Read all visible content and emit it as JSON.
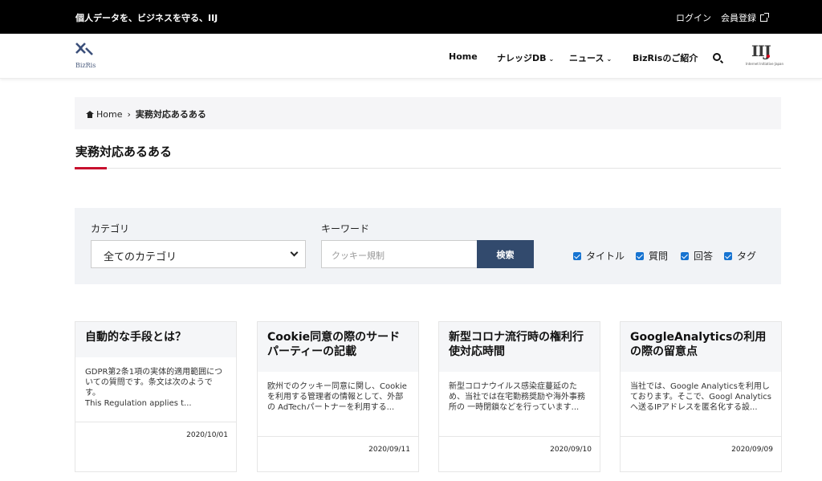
{
  "topbar": {
    "tagline": "個人データを、ビジネスを守る、IIJ",
    "login": "ログイン",
    "register": "会員登録"
  },
  "header": {
    "logo_text": "BizRis",
    "nav": [
      {
        "label": "Home",
        "caret": false
      },
      {
        "label": "ナレッジDB",
        "caret": true
      },
      {
        "label": "ニュース",
        "caret": true
      },
      {
        "label": "BizRisのご紹介",
        "caret": false
      }
    ],
    "partner_logo": "IIJ",
    "partner_sub": "Internet Initiative Japan"
  },
  "breadcrumb": {
    "home": "Home",
    "separator": "›",
    "current": "実務対応あるある"
  },
  "page_title": "実務対応あるある",
  "search": {
    "category_label": "カテゴリ",
    "category_value": "全てのカテゴリ",
    "keyword_label": "キーワード",
    "keyword_placeholder": "クッキー規制",
    "button": "検索",
    "checkboxes": [
      "タイトル",
      "質問",
      "回答",
      "タグ"
    ]
  },
  "cards": [
    {
      "title": "自動的な手段とは？",
      "excerpt": "GDPR第2条1項の実体的適用範囲についての質問です。条文は次のようです。\nThis Regulation applies t...",
      "date": "2020/10/01"
    },
    {
      "title": "Cookie同意の際のサードパーティーの記載",
      "excerpt": "欧州でのクッキー同意に関し、Cookieを利用する管理者の情報として、外部の AdTechパートナーを利用する...",
      "date": "2020/09/11"
    },
    {
      "title": "新型コロナ流行時の権利行使対応時間",
      "excerpt": "新型コロナウイルス感染症蔓延のため、当社では在宅勤務奨励や海外事務所の 一時閉鎖などを行っています...",
      "date": "2020/09/10"
    },
    {
      "title": "GoogleAnalyticsの利用の際の留意点",
      "excerpt": "当社では、Google Analyticsを利用しております。そこで、Googl Analyticsへ送るIPアドレスを匿名化する設...",
      "date": "2020/09/09"
    }
  ],
  "colors": {
    "accent_red": "#c8102e",
    "button_navy": "#324a6d",
    "checkbox_blue": "#1673d1"
  }
}
